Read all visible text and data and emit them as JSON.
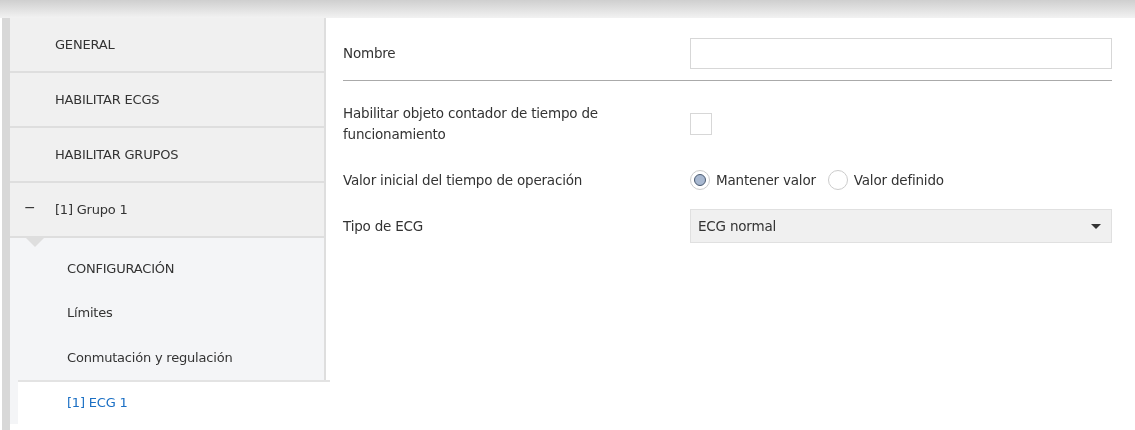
{
  "sidebar": {
    "items": [
      {
        "label": "GENERAL",
        "selected": false
      },
      {
        "label": "HABILITAR ECGS",
        "selected": false
      },
      {
        "label": "HABILITAR GRUPOS",
        "selected": false
      },
      {
        "label": "[1] Grupo 1",
        "selected": false,
        "expanded": true,
        "toggle": "−",
        "children": [
          {
            "label": "CONFIGURACIÓN",
            "selected": false
          },
          {
            "label": "Límites",
            "selected": false
          },
          {
            "label": "Conmutación y regulación",
            "selected": false
          },
          {
            "label": "[1] ECG 1",
            "selected": true
          }
        ]
      }
    ]
  },
  "fields": [
    {
      "kind": "text",
      "label": "Nombre"
    },
    {
      "kind": "divider"
    },
    {
      "kind": "checkbox",
      "label": "Habilitar objeto contador de tiempo de funcionamiento",
      "checked": false
    },
    {
      "kind": "radio",
      "label": "Valor inicial del tiempo de operación",
      "options": [
        {
          "label": "Mantener valor",
          "selected": true
        },
        {
          "label": "Valor definido",
          "selected": false
        }
      ]
    },
    {
      "kind": "dropdown",
      "label": "Tipo de ECG",
      "value": "ECG normal"
    }
  ]
}
